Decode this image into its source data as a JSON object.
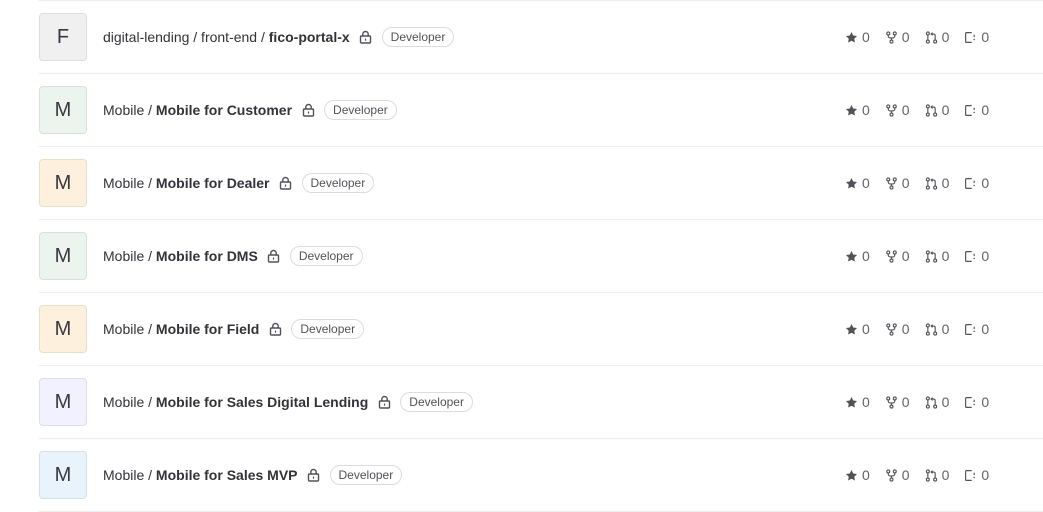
{
  "projects": [
    {
      "avatar_letter": "F",
      "avatar_color": "#f0f0f0",
      "namespace": "digital-lending / front-end / ",
      "name": "fico-portal-x",
      "role": "Developer",
      "stars": "0",
      "forks": "0",
      "merge_requests": "0",
      "issues": "0"
    },
    {
      "avatar_letter": "M",
      "avatar_color": "#ecf4ee",
      "namespace": "Mobile / ",
      "name": "Mobile for Customer",
      "role": "Developer",
      "stars": "0",
      "forks": "0",
      "merge_requests": "0",
      "issues": "0"
    },
    {
      "avatar_letter": "M",
      "avatar_color": "#fdf1dd",
      "namespace": "Mobile / ",
      "name": "Mobile for Dealer",
      "role": "Developer",
      "stars": "0",
      "forks": "0",
      "merge_requests": "0",
      "issues": "0"
    },
    {
      "avatar_letter": "M",
      "avatar_color": "#ecf4ee",
      "namespace": "Mobile / ",
      "name": "Mobile for DMS",
      "role": "Developer",
      "stars": "0",
      "forks": "0",
      "merge_requests": "0",
      "issues": "0"
    },
    {
      "avatar_letter": "M",
      "avatar_color": "#fdf1dd",
      "namespace": "Mobile / ",
      "name": "Mobile for Field",
      "role": "Developer",
      "stars": "0",
      "forks": "0",
      "merge_requests": "0",
      "issues": "0"
    },
    {
      "avatar_letter": "M",
      "avatar_color": "#f1f1ff",
      "namespace": "Mobile / ",
      "name": "Mobile for Sales Digital Lending",
      "role": "Developer",
      "stars": "0",
      "forks": "0",
      "merge_requests": "0",
      "issues": "0"
    },
    {
      "avatar_letter": "M",
      "avatar_color": "#e9f3fc",
      "namespace": "Mobile / ",
      "name": "Mobile for Sales MVP",
      "role": "Developer",
      "stars": "0",
      "forks": "0",
      "merge_requests": "0",
      "issues": "0"
    }
  ],
  "icons": {
    "visibility": "lock-icon",
    "stars": "star-icon",
    "forks": "fork-icon",
    "merge_requests": "merge-request-icon",
    "issues": "issues-icon"
  }
}
